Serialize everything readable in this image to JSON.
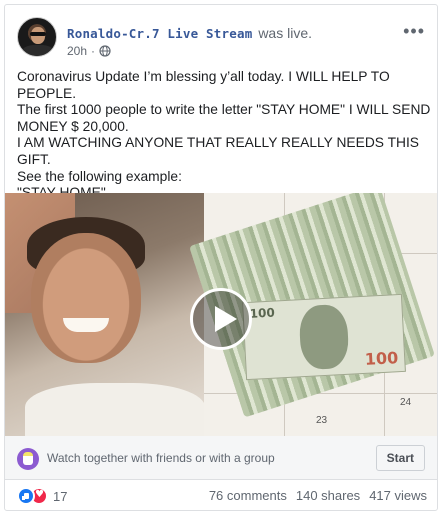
{
  "post": {
    "author": "Ronaldo-Cr.7 Live Stream",
    "action": "was live.",
    "time": "20h",
    "dot": "·",
    "visibility_icon": "globe-icon",
    "more_label": "•••",
    "text": "Coronavirus Update I’m blessing y’all today. I WILL HELP TO PEOPLE.\nThe first 1000 people to write the letter \"STAY HOME\" I WILL SEND MONEY $ 20,000.\nI AM WATCHING ANYONE THAT REALLY REALLY NEEDS THIS GIFT.\nSee the following example:\n\"STAY HOME\"\nGOOD LUCK !!!"
  },
  "media": {
    "play_icon": "play-icon",
    "bill_value_top": "100",
    "bill_value_bottom": "100",
    "calendar_day_a": "23",
    "calendar_day_b": "24"
  },
  "watch_party": {
    "icon": "watch-party-icon",
    "text": "Watch together with friends or with a group",
    "button_label": "Start"
  },
  "footer": {
    "reaction_icons": [
      "like-icon",
      "love-icon"
    ],
    "reaction_count": "17",
    "comments": "76 comments",
    "shares": "140 shares",
    "views": "417 views"
  },
  "colors": {
    "author_link": "#385898",
    "meta_gray": "#606770",
    "like_blue": "#1877f2",
    "love_red": "#f0284a",
    "watch_purple": "#8c5bd1"
  }
}
